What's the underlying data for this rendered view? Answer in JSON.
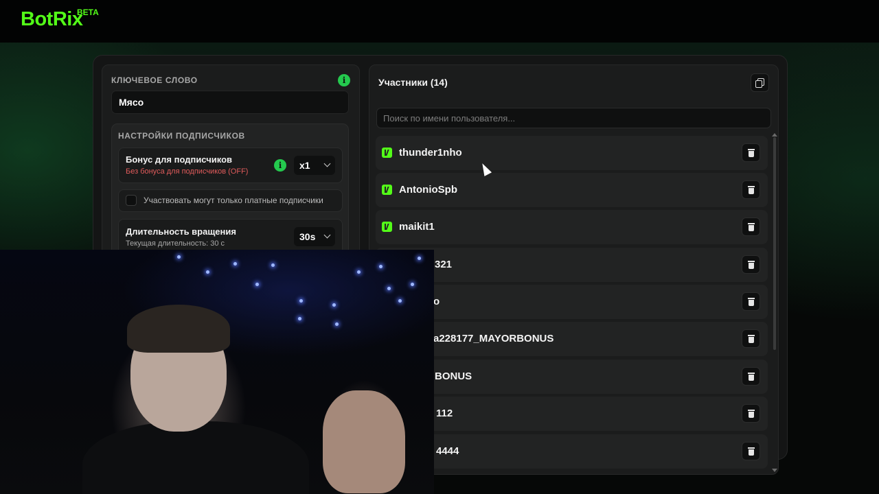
{
  "header": {
    "logo": "BotRix",
    "badge": "BETA"
  },
  "keyword": {
    "label": "КЛЮЧЕВОЕ СЛОВО",
    "value": "Мясо",
    "info_icon": "info-icon"
  },
  "subscriber_settings": {
    "title": "НАСТРОЙКИ ПОДПИСЧИКОВ",
    "bonus": {
      "title": "Бонус для подписчиков",
      "subtitle": "Без бонуса для подписчиков (OFF)",
      "value": "x1",
      "subtitle_color": "#e05b5b"
    },
    "paid_only": {
      "label": "Участвовать могут только платные подписчики",
      "checked": false
    },
    "spin_duration": {
      "title": "Длительность вращения",
      "subtitle": "Текущая длительность: 30 с",
      "value": "30s"
    }
  },
  "participants": {
    "title": "Участники (14)",
    "search_placeholder": "Поиск по имени пользователя...",
    "users": [
      {
        "name": "thunder1nho",
        "platform_icon": "kick-icon"
      },
      {
        "name": "AntonioSpb",
        "platform_icon": "kick-icon"
      },
      {
        "name": "maikit1",
        "platform_icon": "kick-icon"
      },
      {
        "name": "321",
        "platform_icon": "kick-icon"
      },
      {
        "name": "o",
        "platform_icon": "kick-icon"
      },
      {
        "name": "a228177_MAYORBONUS",
        "platform_icon": "kick-icon"
      },
      {
        "name": "BONUS",
        "platform_icon": "kick-icon"
      },
      {
        "name": "112",
        "platform_icon": "kick-icon"
      },
      {
        "name": "4444",
        "platform_icon": "kick-icon"
      }
    ]
  },
  "colors": {
    "accent": "#53fc18",
    "info": "#24c94e",
    "background": "#07090a",
    "panel": "#1b1c1c"
  }
}
